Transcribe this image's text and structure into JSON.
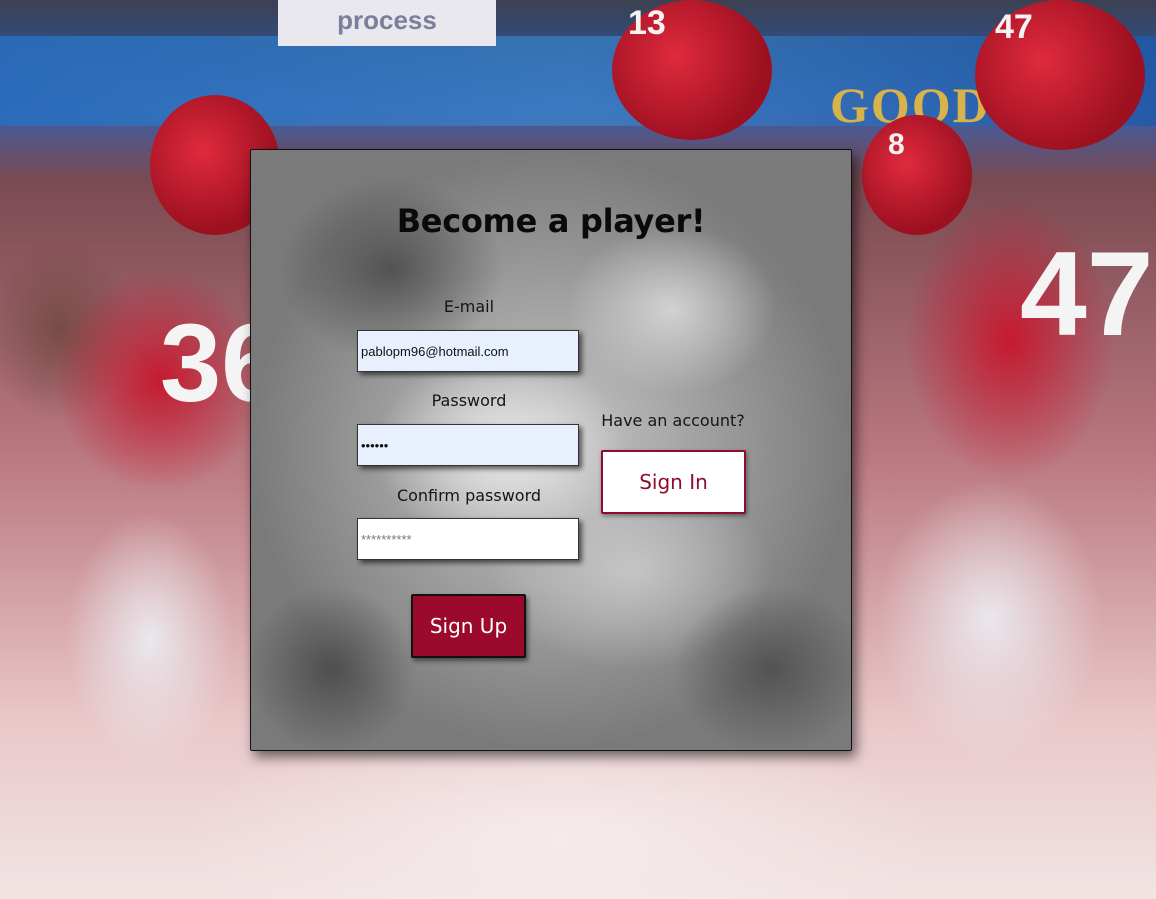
{
  "background": {
    "signs": {
      "process": "process",
      "good": "GOOD"
    },
    "jersey_numbers": [
      "36",
      "13",
      "47",
      "8",
      "47"
    ],
    "accent_colors": {
      "crimson": "#9b0a2c",
      "panel_gray": "#9a9a9a"
    }
  },
  "form": {
    "title": "Become a player!",
    "email": {
      "label": "E-mail",
      "value": "pablopm96@hotmail.com"
    },
    "password": {
      "label": "Password",
      "value": "••••••"
    },
    "confirm_password": {
      "label": "Confirm password",
      "placeholder": "**********"
    },
    "signup_label": "Sign Up",
    "have_account_text": "Have an account?",
    "signin_label": "Sign In"
  }
}
